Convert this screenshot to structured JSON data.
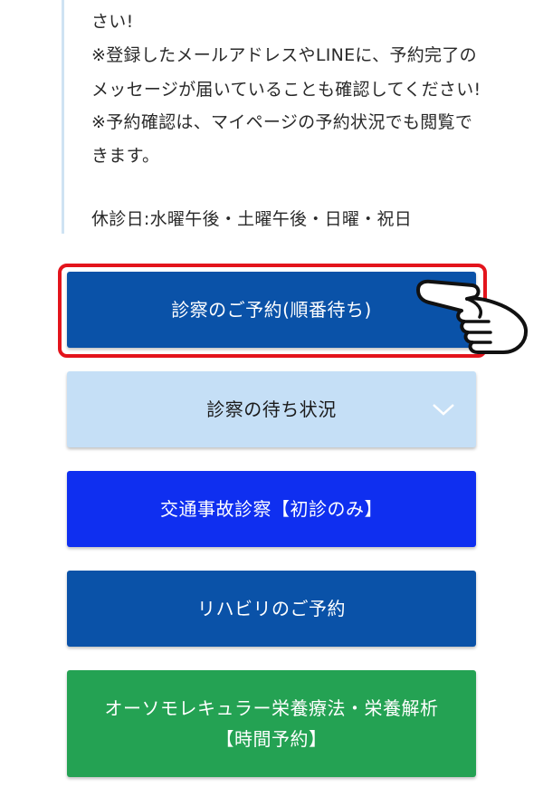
{
  "notice": {
    "lines": [
      "さい!",
      "※登録したメールアドレスやLINEに、予約完了の",
      "メッセージが届いていることも確認してください!",
      "※予約確認は、マイページの予約状況でも閲覧で",
      "きます。"
    ],
    "holidays": "休診日:水曜午後・土曜午後・日曜・祝日"
  },
  "buttons": {
    "reservation": "診察のご予約(順番待ち)",
    "wait_status": "診察の待ち状況",
    "traffic_accident": "交通事故診察【初診のみ】",
    "rehab": "リハビリのご予約",
    "orthomolecular_line1": "オーソモレキュラー栄養療法・栄養解析",
    "orthomolecular_line2": "【時間予約】"
  },
  "colors": {
    "reservation_bg": "#0a52a8",
    "wait_status_bg": "#c5dff6",
    "traffic_bg": "#0f2ff0",
    "rehab_bg": "#0a52a8",
    "ortho_bg": "#24a253",
    "highlight_border": "#e3141c"
  },
  "icons": {
    "pointer": "pointing-hand-icon",
    "expand": "chevron-down-icon"
  }
}
